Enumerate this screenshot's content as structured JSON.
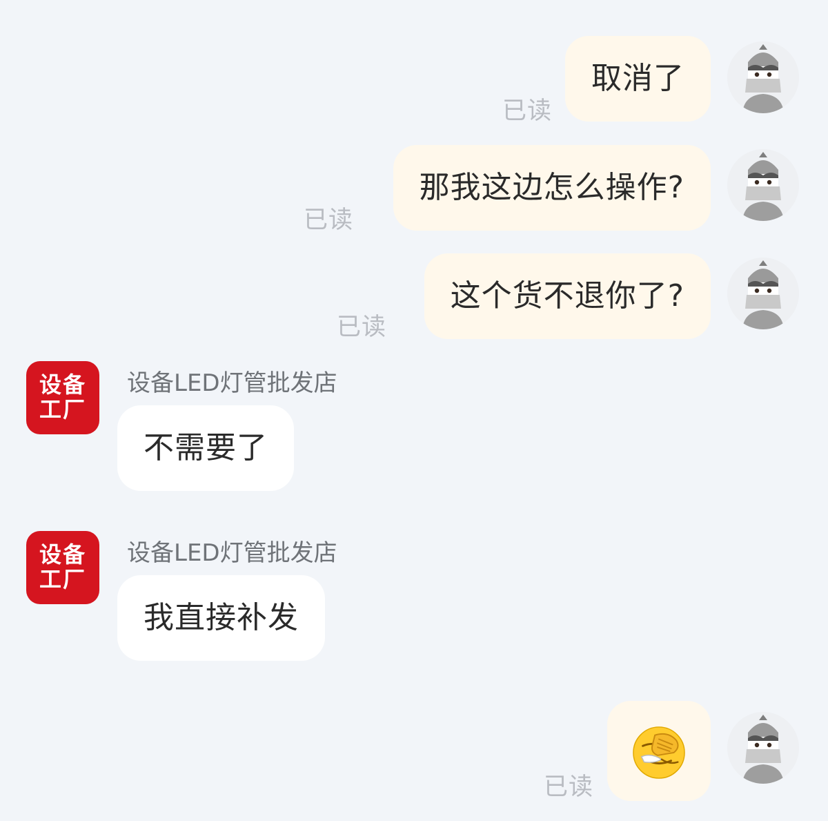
{
  "read_label": "已读",
  "messages": [
    {
      "direction": "out",
      "text": "取消了",
      "status": "已读"
    },
    {
      "direction": "out",
      "text": "那我这边怎么操作?",
      "status": "已读"
    },
    {
      "direction": "out",
      "text": "这个货不退你了?",
      "status": "已读"
    },
    {
      "direction": "in",
      "sender": "设备LED灯管批发店",
      "text": "不需要了"
    },
    {
      "direction": "in",
      "sender": "设备LED灯管批发店",
      "text": "我直接补发"
    },
    {
      "direction": "out",
      "emoji": "face-with-hand-over-eyes-emoji",
      "status": "已读"
    }
  ],
  "shop_avatar": {
    "line1": "设备",
    "line2": "工厂",
    "color": "#d5151f"
  },
  "colors": {
    "background": "#f2f5f9",
    "outgoing_bubble": "#fff8eb",
    "incoming_bubble": "#ffffff",
    "read_status": "#b9bcc2"
  }
}
